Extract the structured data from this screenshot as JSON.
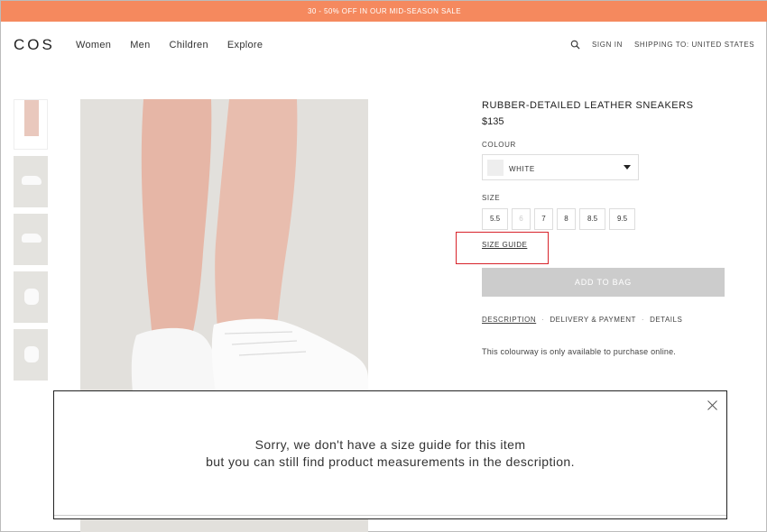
{
  "promo": {
    "text": "30 - 50% OFF IN OUR MID-SEASON SALE"
  },
  "header": {
    "logo": "COS",
    "nav": [
      "Women",
      "Men",
      "Children",
      "Explore"
    ],
    "sign_in": "SIGN IN",
    "shipping": "SHIPPING TO:  UNITED STATES"
  },
  "icons": {
    "search": "search-icon",
    "close": "close-icon",
    "caret": "chevron-down-icon"
  },
  "product": {
    "title": "RUBBER-DETAILED LEATHER SNEAKERS",
    "price": "$135",
    "colour_label": "COLOUR",
    "colour_value": "WHITE",
    "size_label": "SIZE",
    "sizes": [
      {
        "label": "5.5",
        "available": true
      },
      {
        "label": "6",
        "available": false
      },
      {
        "label": "7",
        "available": true
      },
      {
        "label": "8",
        "available": true
      },
      {
        "label": "8.5",
        "available": true
      },
      {
        "label": "9.5",
        "available": true
      }
    ],
    "size_guide": "SIZE GUIDE",
    "add_to_bag": "ADD TO BAG",
    "tabs": [
      "DESCRIPTION",
      "DELIVERY & PAYMENT",
      "DETAILS"
    ],
    "availability": "This colourway is only available to purchase online."
  },
  "modal": {
    "line1": "Sorry, we don't have a size guide for this item",
    "line2": "but you can still find product measurements in the description."
  },
  "colors": {
    "promo_bg": "#f5895e",
    "button_disabled": "#cccccc",
    "highlight": "#d8232a"
  }
}
